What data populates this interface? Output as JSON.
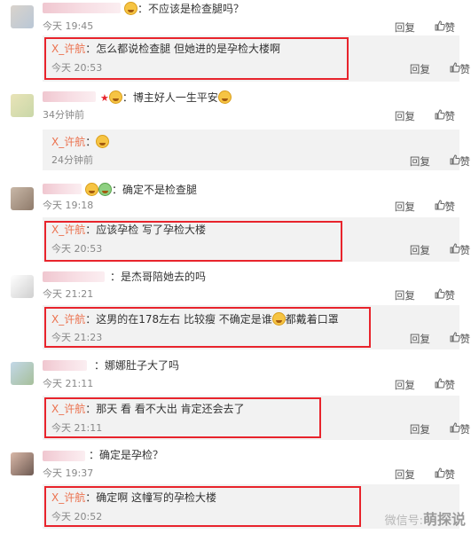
{
  "ui": {
    "reply_label": "回复",
    "like_label": "赞"
  },
  "comments": [
    {
      "text": "：不应该是检查腿吗？",
      "time": "今天 19:45",
      "reply": {
        "name": "X_许航",
        "text": "：怎么都说检查腿 但她进的是孕检大楼啊",
        "time": "今天 20:53"
      }
    },
    {
      "text": "：博主好人一生平安",
      "time": "34分钟前",
      "reply": {
        "name": "X_许航",
        "text": "：",
        "time": "24分钟前"
      }
    },
    {
      "text": "：确定不是检查腿",
      "time": "今天 19:18",
      "reply": {
        "name": "X_许航",
        "text": "：应该孕检 写了孕检大楼",
        "time": "今天 20:53"
      }
    },
    {
      "text": "：是杰哥陪她去的吗",
      "time": "今天 21:21",
      "reply": {
        "name": "X_许航",
        "text": "：这男的在178左右 比较瘦  不确定是谁",
        "text2": "都戴着口罩",
        "time": "今天 21:23"
      }
    },
    {
      "text": "：娜娜肚子大了吗",
      "time": "今天 21:11",
      "reply": {
        "name": "X_许航",
        "text": "：那天 看 看不大出  肯定还会去了",
        "time": "今天 21:11"
      }
    },
    {
      "text": "：确定是孕检？",
      "time": "今天 19:37",
      "reply": {
        "name": "X_许航",
        "text": "：确定啊 这幢写的孕检大楼",
        "time": "今天 20:52"
      }
    }
  ],
  "watermark": {
    "prefix": "微信号:",
    "brand": "萌探说"
  },
  "colors": {
    "frame": "#e8242c",
    "reply_name": "#eb7350",
    "reply_bg": "#f2f2f2"
  }
}
